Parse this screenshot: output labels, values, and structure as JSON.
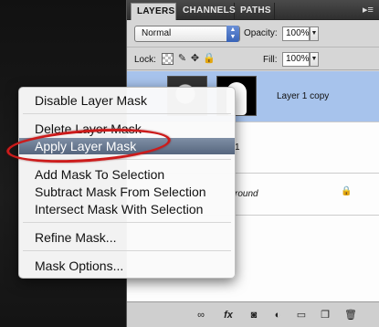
{
  "panel": {
    "tabs": [
      {
        "label": "LAYERS",
        "active": true
      },
      {
        "label": "CHANNELS",
        "active": false
      },
      {
        "label": "PATHS",
        "active": false
      }
    ],
    "blend_mode": "Normal",
    "opacity_label": "Opacity:",
    "opacity_value": "100%",
    "lock_label": "Lock:",
    "fill_label": "Fill:",
    "fill_value": "100%",
    "layers": [
      {
        "name": "Layer 1 copy",
        "selected": true
      },
      {
        "name": "1",
        "selected": false
      },
      {
        "name": "round",
        "selected": false
      }
    ]
  },
  "context_menu": {
    "items": [
      {
        "label": "Disable Layer Mask"
      },
      {
        "label": "Delete Layer Mask"
      },
      {
        "label": "Apply Layer Mask",
        "highlighted": true
      },
      {
        "label": "Add Mask To Selection"
      },
      {
        "label": "Subtract Mask From Selection"
      },
      {
        "label": "Intersect Mask With Selection"
      },
      {
        "label": "Refine Mask..."
      },
      {
        "label": "Mask Options..."
      }
    ]
  },
  "icons": {
    "bottom": [
      "link-icon",
      "fx-icon",
      "add-mask-icon",
      "adjustment-icon",
      "group-icon",
      "new-layer-icon",
      "trash-icon"
    ]
  },
  "colors": {
    "highlight": "#56667e",
    "selection": "#a7c3ec",
    "annotation_ring": "#cc1b1b"
  }
}
